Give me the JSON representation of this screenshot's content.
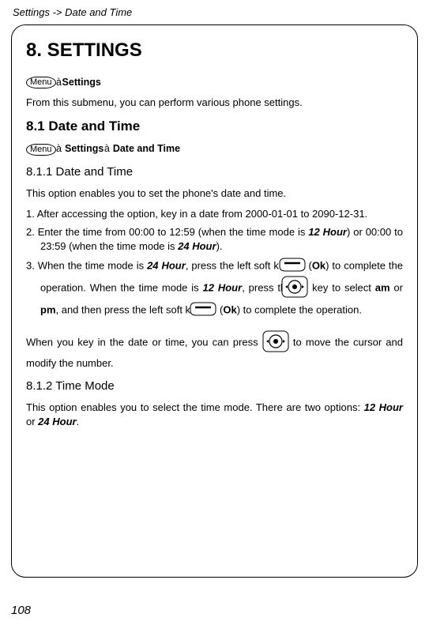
{
  "breadcrumb": "Settings -> Date and Time",
  "h1": "8. SETTINGS",
  "menuKeyLabel": "Menu",
  "nav1_settings": "Settings",
  "intro": "From this submenu, you can perform various phone settings.",
  "h2": "8.1 Date and Time",
  "nav2_settings": "Settings",
  "nav2_datetime": "Date and Time",
  "h3_1": "8.1.1 Date and Time",
  "p_811": "This option enables you to set the phone's date and time.",
  "li1_a": "1. After accessing the option, key in a date from 2000-01-01 to 2090-12-31.",
  "li2_a": "2. Enter the time from 00:00 to 12:59 (when the time mode is ",
  "li2_b": "12 Hour",
  "li2_c": ") or 00:00 to 23:59 (when the time mode is ",
  "li2_d": "24 Hour",
  "li2_e": ").",
  "li3_a": "3. When the time mode is ",
  "li3_b": "24 Hour",
  "li3_c": ", press the left soft key ",
  "li3_d": " (",
  "li3_e": "Ok",
  "li3_f": ") to complete the operation. When the time mode is ",
  "li3_g": "12 Hour",
  "li3_h": ", press the ",
  "li3_i": " key to select ",
  "li3_j": "am",
  "li3_k": " or ",
  "li3_l": "pm",
  "li3_m": ", and then press the left soft key ",
  "li3_n": " (",
  "li3_o": "Ok",
  "li3_p": ") to complete the operation.",
  "note_a": "When you key in the date or time, you can press ",
  "note_b": " to move the cursor and modify the number.",
  "h3_2": "8.1.2 Time Mode",
  "p_812_a": "This option enables you to select the time mode. There are two options: ",
  "p_812_b": "12 Hour",
  "p_812_c": " or ",
  "p_812_d": "24 Hour",
  "p_812_e": ".",
  "pageNum": "108"
}
